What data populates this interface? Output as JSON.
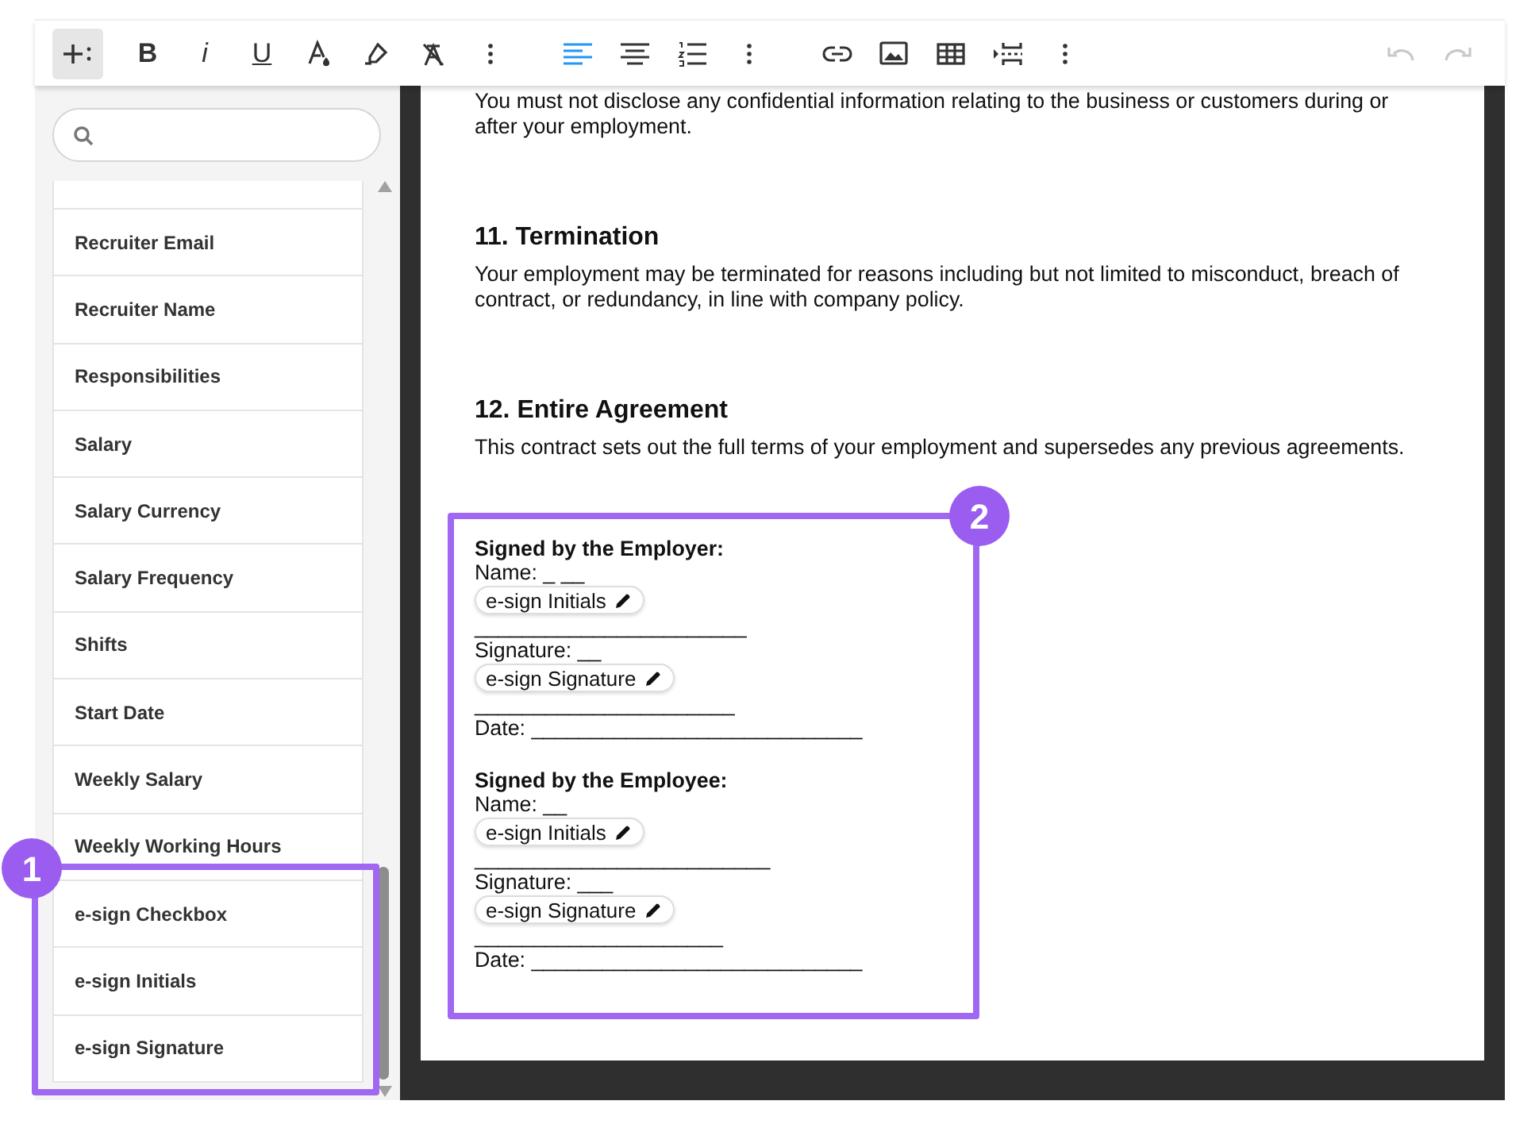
{
  "toolbar": {
    "groups": [
      {
        "buttons": [
          {
            "kind": "icon",
            "selected": false,
            "disabled": false
          }
        ]
      },
      {
        "buttons": [
          {
            "kind": "glyph",
            "label": "B",
            "selected": false,
            "disabled": false
          },
          {
            "kind": "glyph",
            "label": "i",
            "selected": false,
            "disabled": false
          },
          {
            "kind": "glyph",
            "label": "U",
            "selected": false,
            "disabled": false
          },
          {
            "kind": "icon",
            "selected": false,
            "disabled": false
          },
          {
            "kind": "icon",
            "selected": false,
            "disabled": false
          },
          {
            "kind": "icon",
            "selected": false,
            "disabled": false
          },
          {
            "kind": "icon",
            "selected": false,
            "disabled": false
          }
        ]
      },
      {
        "buttons": [
          {
            "kind": "icon",
            "selected": true,
            "disabled": false
          },
          {
            "kind": "icon",
            "selected": false,
            "disabled": false
          },
          {
            "kind": "icon",
            "selected": false,
            "disabled": false
          },
          {
            "kind": "icon",
            "selected": false,
            "disabled": false
          }
        ]
      },
      {
        "buttons": [
          {
            "kind": "icon",
            "selected": false,
            "disabled": false
          },
          {
            "kind": "icon",
            "selected": false,
            "disabled": false
          },
          {
            "kind": "icon",
            "selected": false,
            "disabled": false
          },
          {
            "kind": "icon",
            "selected": false,
            "disabled": false
          },
          {
            "kind": "icon",
            "selected": false,
            "disabled": false
          }
        ]
      },
      {
        "buttons": [
          {
            "kind": "icon",
            "selected": false,
            "disabled": true
          },
          {
            "kind": "icon",
            "selected": false,
            "disabled": true
          }
        ]
      }
    ]
  },
  "sidebar": {
    "items": [
      {
        "label": "Recruiter Email"
      },
      {
        "label": "Recruiter Name"
      },
      {
        "label": "Responsibilities"
      },
      {
        "label": "Salary"
      },
      {
        "label": "Salary Currency"
      },
      {
        "label": "Salary Frequency"
      },
      {
        "label": "Shifts"
      },
      {
        "label": "Start Date"
      },
      {
        "label": "Weekly Salary"
      },
      {
        "label": "Weekly Working Hours"
      },
      {
        "label": "e-sign Checkbox"
      },
      {
        "label": "e-sign Initials"
      },
      {
        "label": "e-sign Signature"
      }
    ]
  },
  "document": {
    "intro": "You must not disclose any confidential information relating to the business or customers during or after your employment.",
    "sections": [
      {
        "heading": "11. Termination",
        "body": "Your employment may be terminated for reasons including but not limited to misconduct, breach of contract, or redundancy, in line with company policy."
      },
      {
        "heading": "12. Entire Agreement",
        "body": "This contract sets out the full terms of your employment and supersedes any previous agreements."
      }
    ],
    "signature_blocks": [
      {
        "heading": "Signed by the Employer:",
        "lines": [
          {
            "kind": "text",
            "text": "Name: _ __"
          },
          {
            "kind": "chip",
            "text": "e-sign Initials"
          },
          {
            "kind": "text",
            "text": "_______________________"
          },
          {
            "kind": "text",
            "text": "Signature: __"
          },
          {
            "kind": "chip",
            "text": "e-sign Signature"
          },
          {
            "kind": "text",
            "text": "______________________"
          },
          {
            "kind": "text",
            "text": "Date: ____________________________"
          }
        ]
      },
      {
        "heading": "Signed by the Employee:",
        "lines": [
          {
            "kind": "text",
            "text": "Name: __"
          },
          {
            "kind": "chip",
            "text": "e-sign Initials"
          },
          {
            "kind": "text",
            "text": "_________________________"
          },
          {
            "kind": "text",
            "text": "Signature: ___"
          },
          {
            "kind": "chip",
            "text": "e-sign Signature"
          },
          {
            "kind": "text",
            "text": "_____________________"
          },
          {
            "kind": "text",
            "text": "Date: ____________________________"
          }
        ]
      }
    ]
  },
  "callouts": [
    {
      "number": "1"
    },
    {
      "number": "2"
    }
  ]
}
